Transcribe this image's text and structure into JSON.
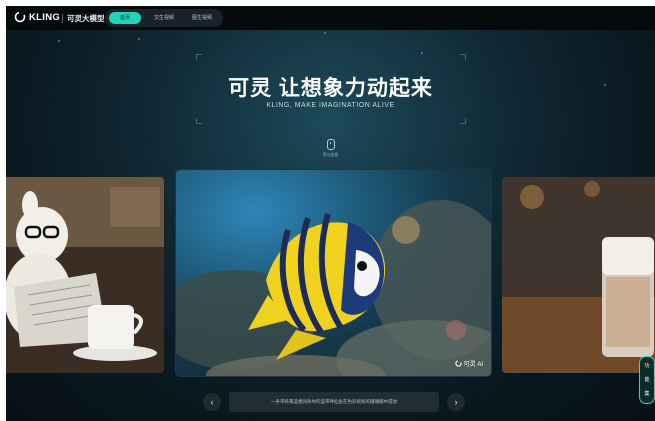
{
  "nav": {
    "logo_text": "KLING",
    "product_name": "可灵大模型",
    "tabs": [
      {
        "label": "首页",
        "active": true
      },
      {
        "label": "文生视频",
        "active": false
      },
      {
        "label": "图生视频",
        "active": false
      }
    ]
  },
  "hero": {
    "title": "可灵 让想象力动起来",
    "subtitle": "KLING, MAKE IMAGINATION ALIVE",
    "scroll_hint": "滑动查看"
  },
  "carousel": {
    "watermark": "可灵 AI",
    "caption": "一条带有黄蓝相间条纹的蓝带神仙鱼在色彩缤纷的珊瑚礁中游动",
    "prev_icon": "chevron-left-icon",
    "next_icon": "chevron-right-icon",
    "prev_glyph": "‹",
    "next_glyph": "›"
  },
  "side_tool": {
    "items": [
      "功",
      "能",
      "集"
    ]
  },
  "colors": {
    "accent": "#21d6b8",
    "background": "#0a1820",
    "topbar": "#050a0d"
  }
}
